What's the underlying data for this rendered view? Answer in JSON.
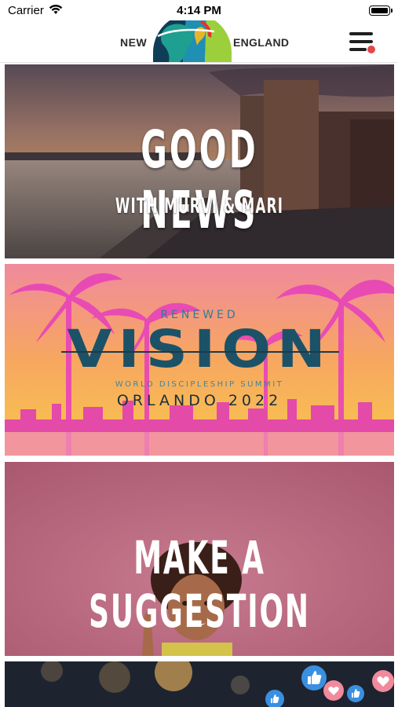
{
  "status_bar": {
    "carrier": "Carrier",
    "time": "4:14 PM"
  },
  "header": {
    "brand_left": "NEW",
    "brand_right": "ENGLAND",
    "logo_icon": "globe-logo-icon",
    "menu_icon": "hamburger-menu-icon",
    "notification_color": "#e34848"
  },
  "cards": {
    "good_news": {
      "title": "GOOD NEWS",
      "subtitle": "WITH MURVI & MARI"
    },
    "vision": {
      "top_word": "RENEWED",
      "main_word": "VISION",
      "summit": "WORLD DISCIPLESHIP SUMMIT",
      "location_year": "ORLANDO 2022",
      "colors": {
        "accent": "#1c5268",
        "palm": "#e845b8",
        "sky_top": "#f08a9c",
        "sky_bottom": "#f8c84c"
      }
    },
    "suggestion": {
      "title": "MAKE A SUGGESTION"
    },
    "social": {
      "icons": [
        "like-icon",
        "heart-icon"
      ]
    }
  }
}
